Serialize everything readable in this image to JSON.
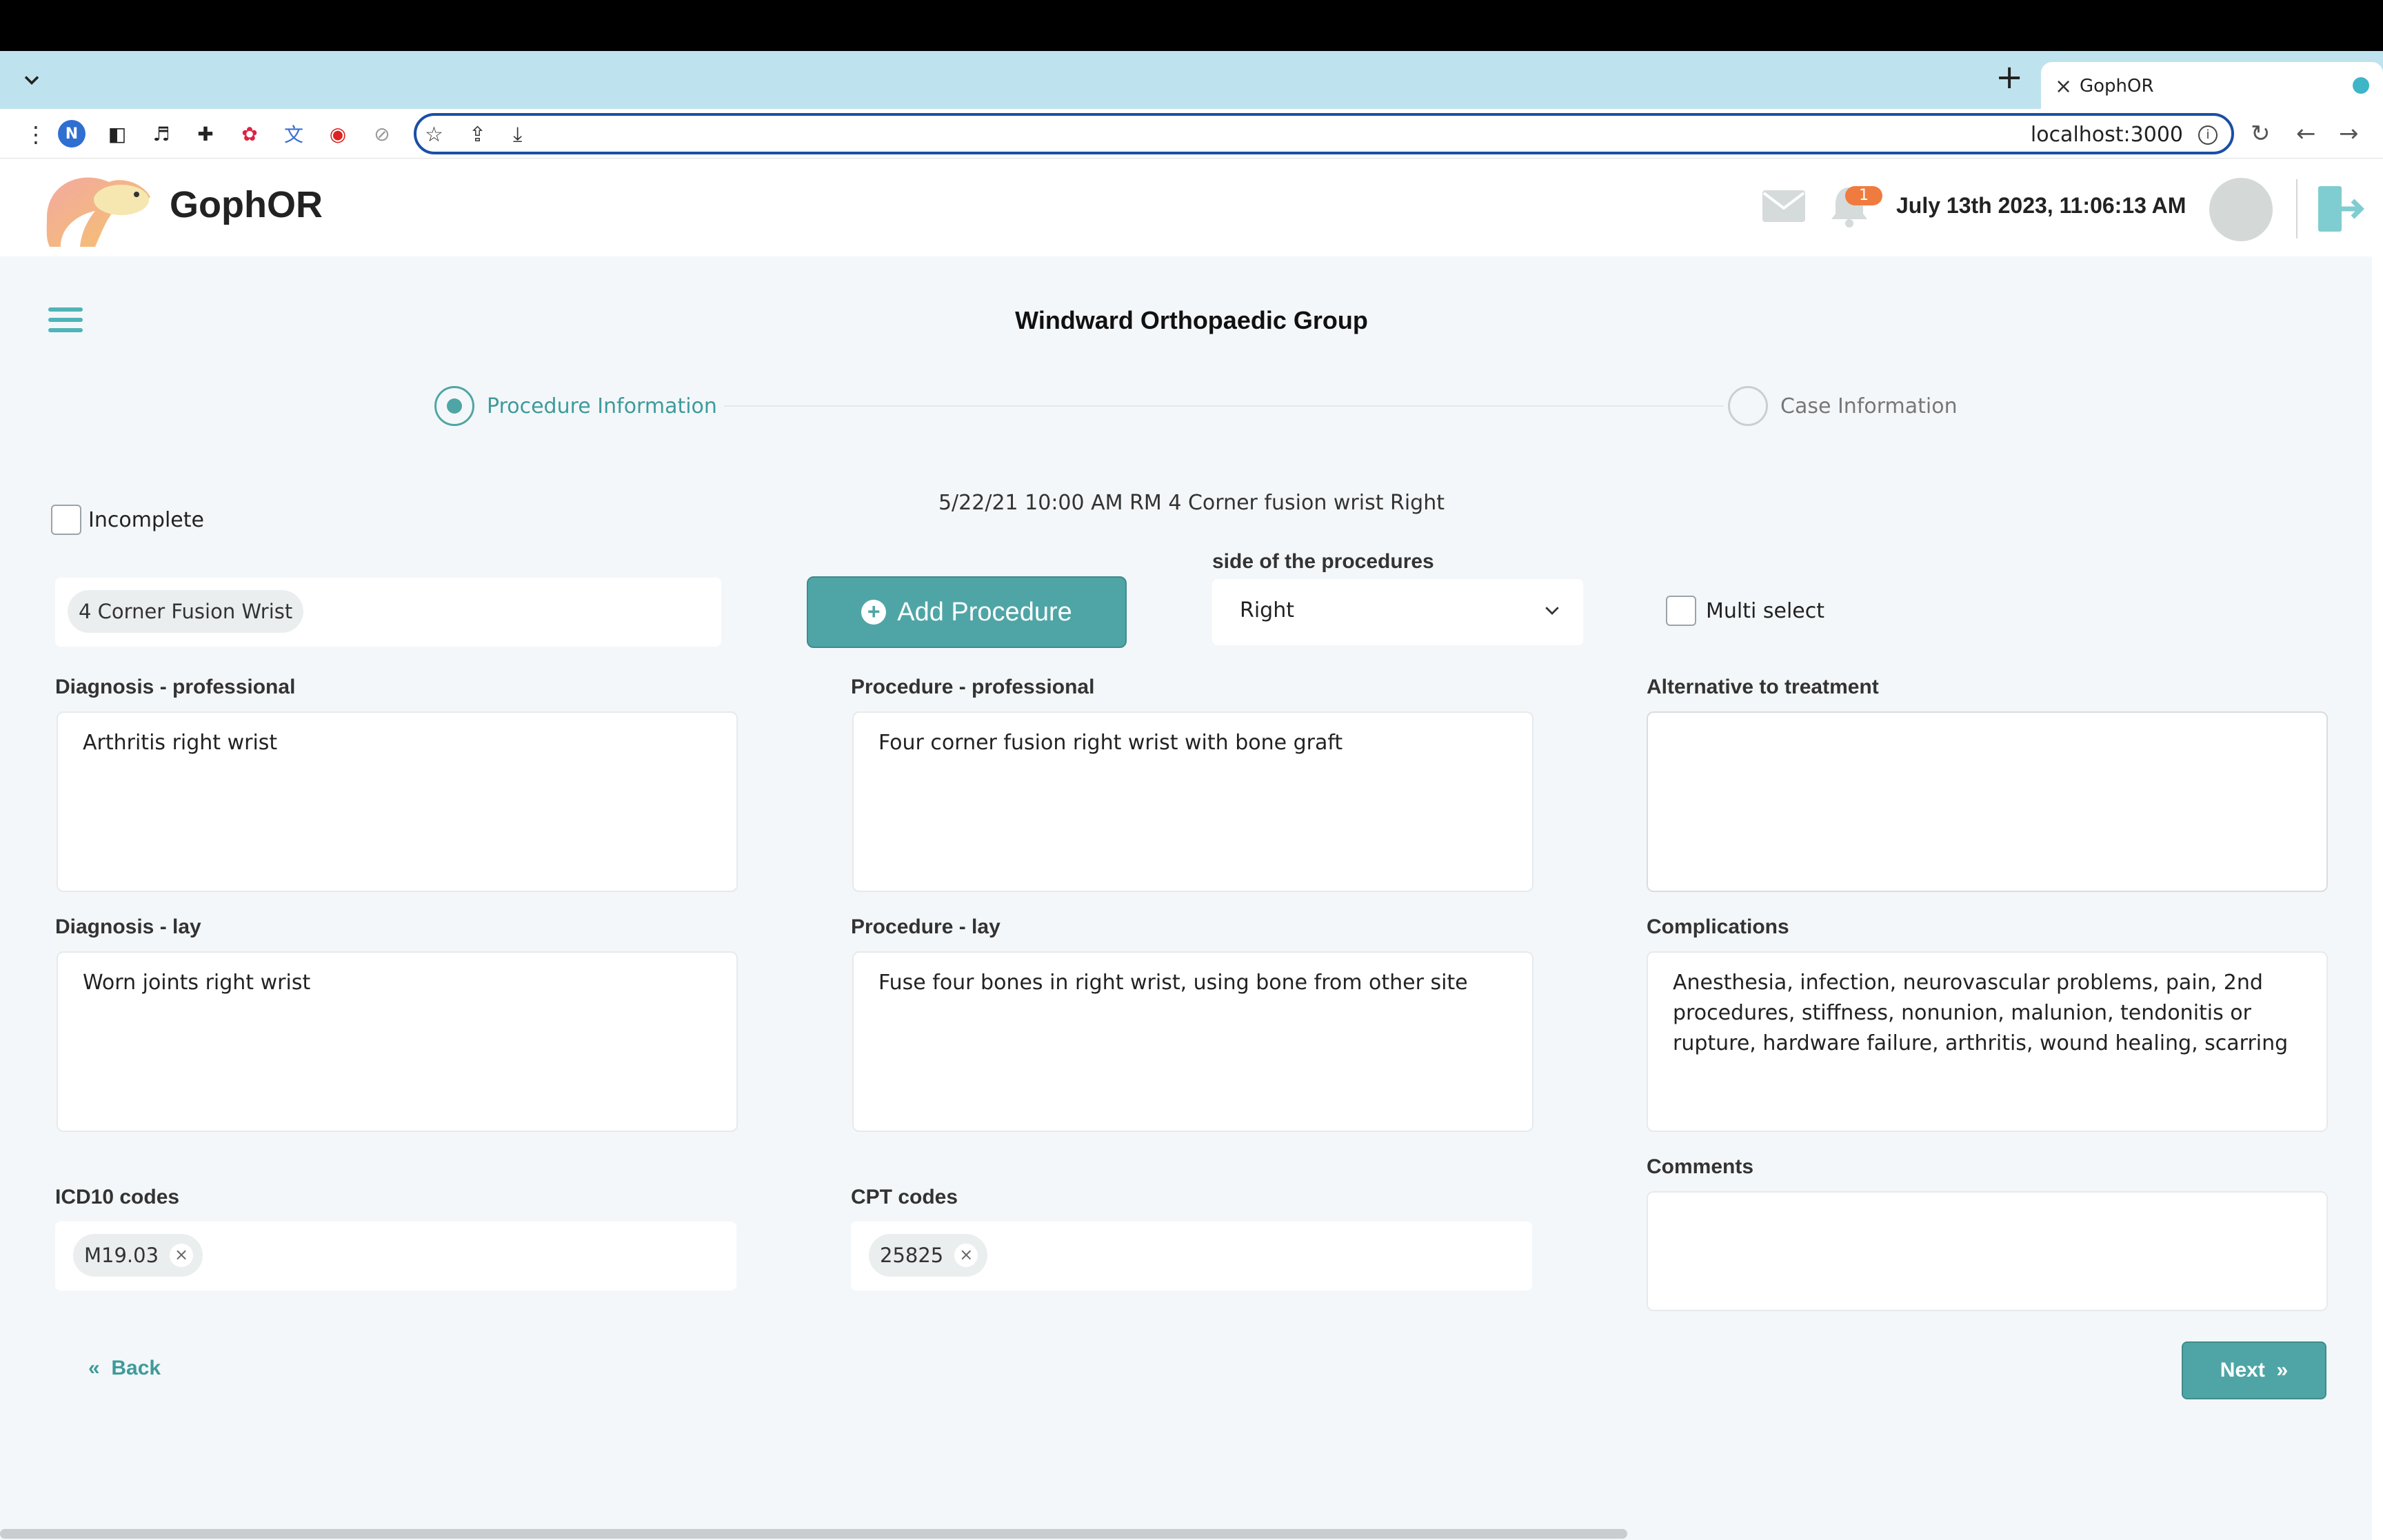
{
  "browser": {
    "tab_title": "GophOR",
    "url": "localhost:3000",
    "profile_initial": "N"
  },
  "header": {
    "brand": "GophOR",
    "notification_count": "1",
    "datetime": "July 13th 2023, 11:06:13 AM"
  },
  "main": {
    "org_title": "Windward Orthopaedic Group",
    "steps": [
      {
        "label": "Procedure Information",
        "active": true
      },
      {
        "label": "Case Information",
        "active": false
      }
    ],
    "incomplete_label": "Incomplete",
    "summary": "5/22/21 10:00 AM RM 4 Corner fusion wrist Right",
    "procedure_chip": "4 Corner Fusion Wrist",
    "add_procedure_label": "Add Procedure",
    "side_label": "side of the procedures",
    "side_value": "Right",
    "multi_select_label": "Multi select",
    "fields": {
      "diagnosis_professional": {
        "label": "Diagnosis - professional",
        "value": "Arthritis right wrist"
      },
      "procedure_professional": {
        "label": "Procedure - professional",
        "value": "Four corner fusion right wrist with bone graft"
      },
      "alternative": {
        "label": "Alternative to treatment",
        "value": ""
      },
      "diagnosis_lay": {
        "label": "Diagnosis - lay",
        "value": "Worn joints right wrist"
      },
      "procedure_lay": {
        "label": "Procedure - lay",
        "value": "Fuse four bones in right wrist, using bone from other site"
      },
      "complications": {
        "label": "Complications",
        "value": "Anesthesia, infection, neurovascular problems, pain, 2nd procedures, stiffness, nonunion, malunion, tendonitis or rupture, hardware failure, arthritis, wound healing, scarring"
      },
      "comments": {
        "label": "Comments",
        "value": ""
      }
    },
    "icd10": {
      "label": "ICD10 codes",
      "codes": [
        "M19.03"
      ]
    },
    "cpt": {
      "label": "CPT codes",
      "codes": [
        "25825"
      ]
    },
    "back_label": "Back",
    "next_label": "Next"
  },
  "colors": {
    "accent": "#4fa5a6",
    "badge": "#f07b3f"
  }
}
